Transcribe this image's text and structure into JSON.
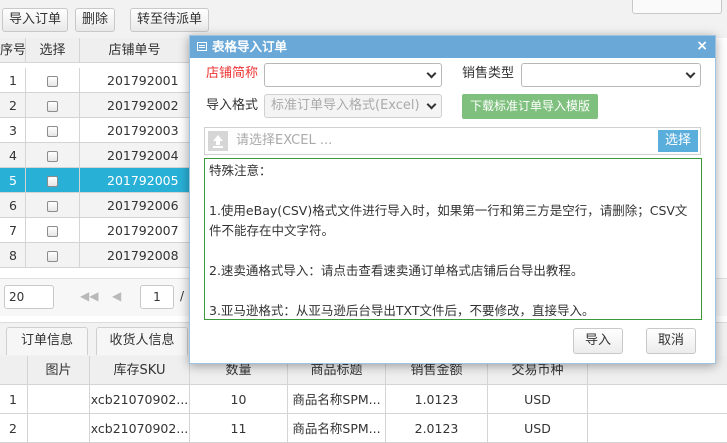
{
  "toolbar": {
    "import_label": "导入订单",
    "delete_label": "删除",
    "transfer_label": "转至待派单"
  },
  "grid": {
    "headers": {
      "no": "序号",
      "select": "选择",
      "order_no": "店铺单号"
    },
    "rows": [
      {
        "no": "1",
        "order_no": "201792001"
      },
      {
        "no": "2",
        "order_no": "201792002"
      },
      {
        "no": "3",
        "order_no": "201792003"
      },
      {
        "no": "4",
        "order_no": "201792004"
      },
      {
        "no": "5",
        "order_no": "201792005"
      },
      {
        "no": "6",
        "order_no": "201792006"
      },
      {
        "no": "7",
        "order_no": "201792007"
      },
      {
        "no": "8",
        "order_no": "201792008"
      }
    ],
    "selected_row": 5
  },
  "pager": {
    "page_size": "20",
    "page": "1",
    "slash": "/"
  },
  "tabs": [
    {
      "label": "订单信息"
    },
    {
      "label": "收货人信息"
    }
  ],
  "detail": {
    "headers": [
      "",
      "图片",
      "库存SKU",
      "数量",
      "商品标题",
      "销售金额",
      "交易币种"
    ],
    "rows": [
      [
        "1",
        "",
        "xcb21070902...",
        "10",
        "商品名称SPM...",
        "1.0123",
        "USD"
      ],
      [
        "2",
        "",
        "xcb21070902...",
        "11",
        "商品名称SPM...",
        "2.0123",
        "USD"
      ]
    ]
  },
  "modal": {
    "title": "表格导入订单",
    "close": "×",
    "shop_label": "店铺简称",
    "shop_value": "",
    "sales_type_label": "销售类型",
    "sales_type_value": "",
    "format_label": "导入格式",
    "format_value": "标准订单导入格式(Excel)",
    "download_label": "下载标准订单导入模版",
    "file_placeholder": "请选择EXCEL ...",
    "choose_label": "选择",
    "notes": {
      "heading": "特殊注意：",
      "item1": "1.使用eBay(CSV)格式文件进行导入时，如果第一行和第三方是空行，请删除；CSV文件不能存在中文字符。",
      "item2": "2.速卖通格式导入：请点击查看速卖通订单格式店铺后台导出教程。",
      "item3": "3.亚马逊格式：从亚马逊后台导出TXT文件后，不要修改，直接导入。"
    },
    "import_button": "导入",
    "cancel_button": "取消"
  },
  "colors": {
    "accent": "#6aa8d8",
    "selected_row": "#29b0d6",
    "download_button": "#7fc07f",
    "required_label": "#e33333",
    "notes_border": "#3a9a3a"
  }
}
